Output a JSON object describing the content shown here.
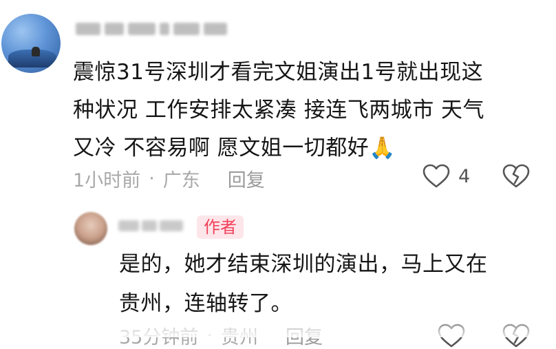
{
  "comment": {
    "username": "",
    "text": "震惊31号深圳才看完文姐演出1号就出现这\n种状况 工作安排太紧凑 接连飞两城市 天气\n又冷 不容易啊 愿文姐一切都好🙏",
    "time": "1小时前",
    "separator": "·",
    "location": "广东",
    "reply_label": "回复",
    "like_count": "4",
    "like_icon": "heart-outline-icon",
    "dislike_icon": "broken-heart-icon"
  },
  "reply": {
    "username": "",
    "badge": "作者",
    "text": "是的，她才结束深圳的演出，马上又在\n贵州，连轴转了。",
    "time": "35分钟前",
    "separator": "·",
    "location": "贵州",
    "reply_label": "回复",
    "like_icon": "heart-outline-icon",
    "dislike_icon": "broken-heart-icon"
  },
  "colors": {
    "badge_bg": "#fde6ea",
    "badge_text": "#f2415b",
    "meta_text": "#a8a8a8",
    "body_text": "#161616"
  }
}
